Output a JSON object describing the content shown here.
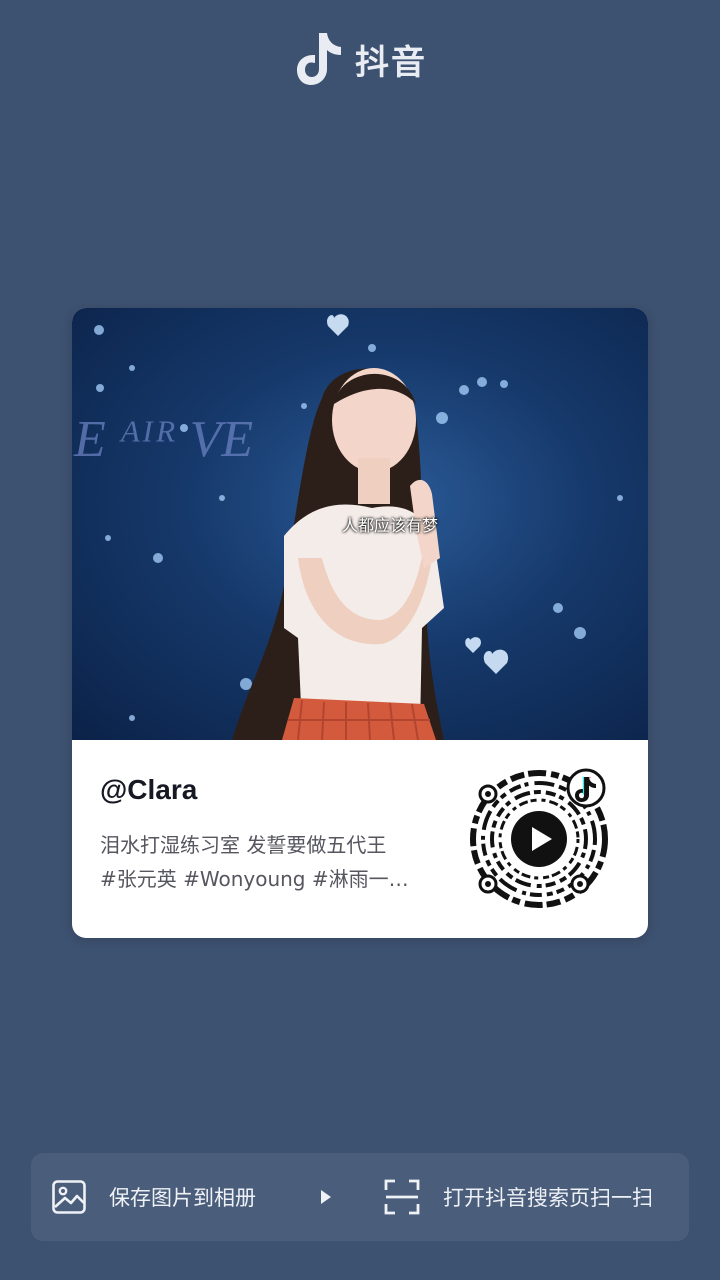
{
  "brand": {
    "name": "抖音"
  },
  "share_card": {
    "cover_caption": "人都应该有梦",
    "username": "@Clara",
    "description_line1": "泪水打湿练习室 发誓要做五代王",
    "description_line2": "#张元英 #Wonyoung #淋雨一…"
  },
  "actions": {
    "save_label": "保存图片到相册",
    "scan_label": "打开抖音搜索页扫一扫"
  },
  "colors": {
    "background": "#3d5170",
    "card": "#ffffff",
    "bottom_bar": "#4a5d7a"
  }
}
